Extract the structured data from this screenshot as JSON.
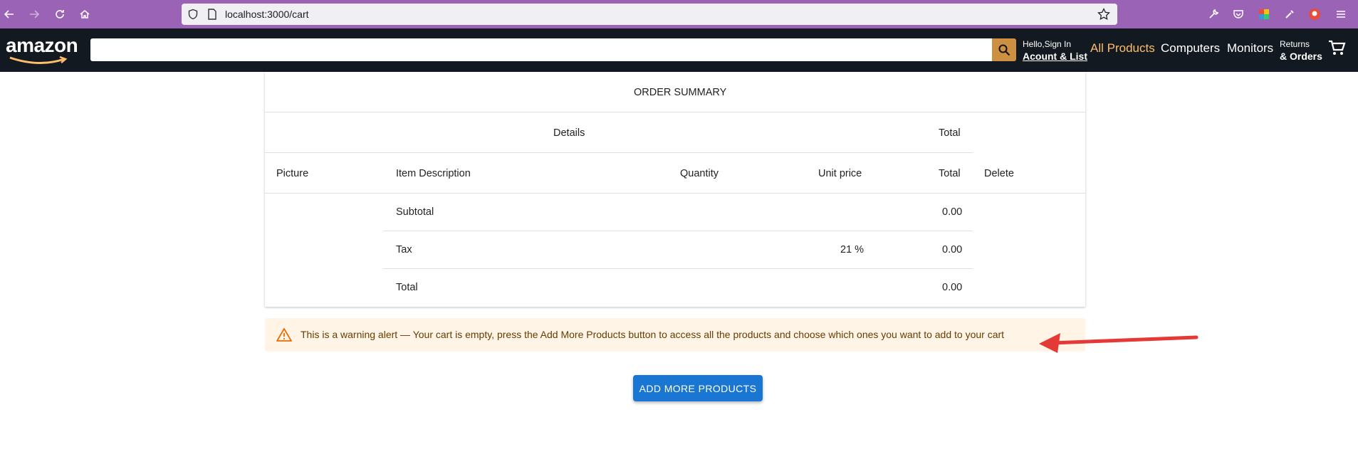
{
  "browser": {
    "url": "localhost:3000/cart"
  },
  "header": {
    "logo": "amazon",
    "hello": "Hello,Sign In",
    "account": "Acount & List",
    "nav": [
      "All Products",
      "Computers",
      "Monitors"
    ],
    "returns": "Returns",
    "orders": "& Orders",
    "accent_color": "#febd69"
  },
  "summary": {
    "title": "ORDER SUMMARY",
    "group_details": "Details",
    "group_total": "Total",
    "columns": {
      "picture": "Picture",
      "description": "Item Description",
      "quantity": "Quantity",
      "unit_price": "Unit price",
      "total": "Total",
      "delete": "Delete"
    },
    "rows": [
      {
        "label": "Subtotal",
        "rate": "",
        "value": "0.00"
      },
      {
        "label": "Tax",
        "rate": "21 %",
        "value": "0.00"
      },
      {
        "label": "Total",
        "rate": "",
        "value": "0.00"
      }
    ]
  },
  "alert": {
    "text": "This is a warning alert — Your cart is empty, press the Add More Products button to access all the products and choose which ones you want to add to your cart",
    "color": "#ed6c02"
  },
  "actions": {
    "add_more": "ADD MORE PRODUCTS"
  }
}
